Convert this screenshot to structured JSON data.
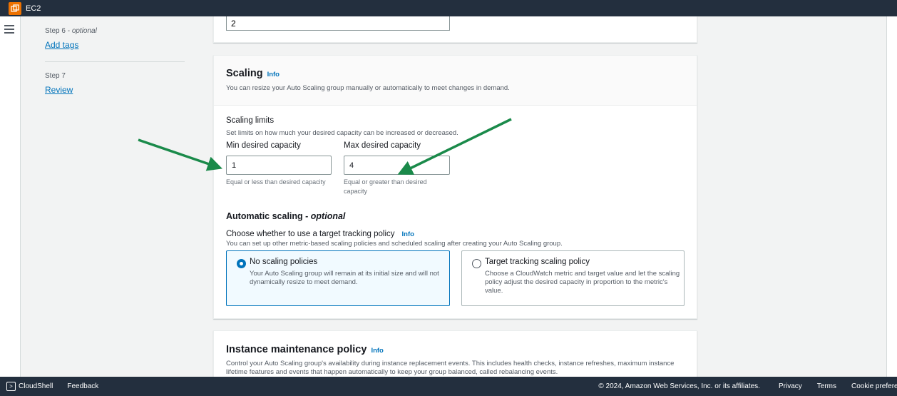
{
  "topbar": {
    "service_name": "EC2"
  },
  "wizard_nav": {
    "steps": [
      {
        "label": "Step 6",
        "optional": "optional",
        "link": "Add tags"
      },
      {
        "label": "Step 7",
        "link": "Review"
      }
    ]
  },
  "group_size": {
    "desired_capacity_value": "2"
  },
  "scaling": {
    "title": "Scaling",
    "info": "Info",
    "description": "You can resize your Auto Scaling group manually or automatically to meet changes in demand.",
    "limits_title": "Scaling limits",
    "limits_description": "Set limits on how much your desired capacity can be increased or decreased.",
    "min_label": "Min desired capacity",
    "min_value": "1",
    "min_constraint": "Equal or less than desired capacity",
    "max_label": "Max desired capacity",
    "max_value": "4",
    "max_constraint": "Equal or greater than desired capacity",
    "auto_title": "Automatic scaling - ",
    "auto_optional": "optional",
    "auto_question": "Choose whether to use a target tracking policy",
    "auto_info": "Info",
    "auto_description": "You can set up other metric-based scaling policies and scheduled scaling after creating your Auto Scaling group.",
    "options": [
      {
        "title": "No scaling policies",
        "description": "Your Auto Scaling group will remain at its initial size and will not dynamically resize to meet demand.",
        "selected": true
      },
      {
        "title": "Target tracking scaling policy",
        "description": "Choose a CloudWatch metric and target value and let the scaling policy adjust the desired capacity in proportion to the metric's value.",
        "selected": false
      }
    ]
  },
  "maintenance": {
    "title": "Instance maintenance policy",
    "info": "Info",
    "description": "Control your Auto Scaling group's availability during instance replacement events. This includes health checks, instance refreshes, maximum instance lifetime features and events that happen automatically to keep your group balanced, called rebalancing events."
  },
  "footer": {
    "cloudshell": "CloudShell",
    "feedback": "Feedback",
    "copyright": "© 2024, Amazon Web Services, Inc. or its affiliates.",
    "privacy": "Privacy",
    "terms": "Terms",
    "cookie": "Cookie prefere"
  },
  "colors": {
    "arrow": "#1a8a4a",
    "link": "#0073bb",
    "nav_dark": "#232f3e"
  }
}
